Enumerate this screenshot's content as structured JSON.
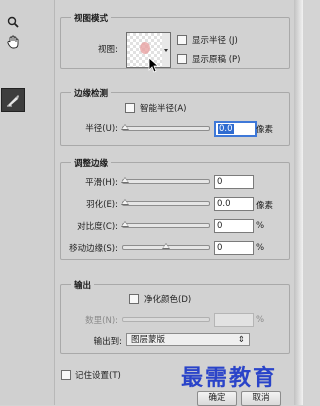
{
  "view_mode": {
    "group_title": "视图模式",
    "view_label": "视图:",
    "show_radius_label": "显示半径 (J)",
    "show_original_label": "显示原稿 (P)"
  },
  "edge_detection": {
    "group_title": "边缘检测",
    "smart_radius_label": "智能半径(A)",
    "radius_label": "半径(U):",
    "radius_value": "0.0",
    "radius_unit": "像素"
  },
  "adjust_edge": {
    "group_title": "调整边缘",
    "rows": [
      {
        "label": "平滑(H):",
        "value": "0",
        "unit": ""
      },
      {
        "label": "羽化(E):",
        "value": "0.0",
        "unit": "像素"
      },
      {
        "label": "对比度(C):",
        "value": "0",
        "unit": "%"
      },
      {
        "label": "移动边缘(S):",
        "value": "0",
        "unit": "%"
      }
    ],
    "slider_positions": [
      0,
      0,
      0,
      0.5
    ]
  },
  "output": {
    "group_title": "输出",
    "decontaminate_label": "净化颜色(D)",
    "amount_label": "数里(N):",
    "amount_unit": "%",
    "output_to_label": "输出到:",
    "output_to_value": "图层蒙版"
  },
  "footer": {
    "remember_settings_label": "记住设置(T)",
    "ok_label": "确定",
    "cancel_label": "取消"
  },
  "watermark": {
    "text": "最需教育"
  }
}
